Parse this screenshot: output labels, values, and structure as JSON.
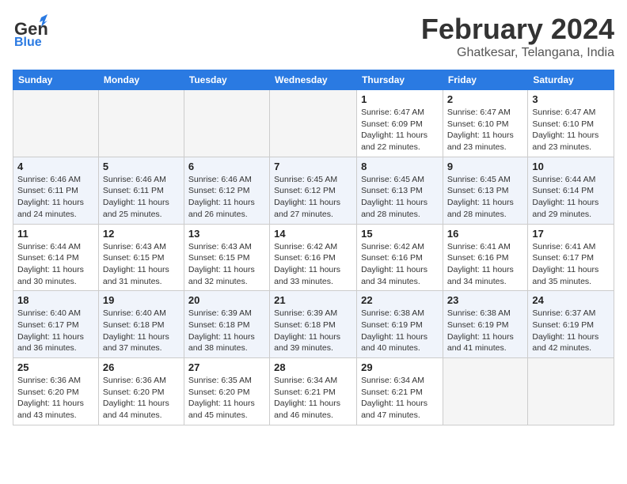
{
  "header": {
    "logo_line1": "General",
    "logo_line2": "Blue",
    "month": "February 2024",
    "location": "Ghatkesar, Telangana, India"
  },
  "weekdays": [
    "Sunday",
    "Monday",
    "Tuesday",
    "Wednesday",
    "Thursday",
    "Friday",
    "Saturday"
  ],
  "weeks": [
    [
      {
        "day": "",
        "info": ""
      },
      {
        "day": "",
        "info": ""
      },
      {
        "day": "",
        "info": ""
      },
      {
        "day": "",
        "info": ""
      },
      {
        "day": "1",
        "info": "Sunrise: 6:47 AM\nSunset: 6:09 PM\nDaylight: 11 hours\nand 22 minutes."
      },
      {
        "day": "2",
        "info": "Sunrise: 6:47 AM\nSunset: 6:10 PM\nDaylight: 11 hours\nand 23 minutes."
      },
      {
        "day": "3",
        "info": "Sunrise: 6:47 AM\nSunset: 6:10 PM\nDaylight: 11 hours\nand 23 minutes."
      }
    ],
    [
      {
        "day": "4",
        "info": "Sunrise: 6:46 AM\nSunset: 6:11 PM\nDaylight: 11 hours\nand 24 minutes."
      },
      {
        "day": "5",
        "info": "Sunrise: 6:46 AM\nSunset: 6:11 PM\nDaylight: 11 hours\nand 25 minutes."
      },
      {
        "day": "6",
        "info": "Sunrise: 6:46 AM\nSunset: 6:12 PM\nDaylight: 11 hours\nand 26 minutes."
      },
      {
        "day": "7",
        "info": "Sunrise: 6:45 AM\nSunset: 6:12 PM\nDaylight: 11 hours\nand 27 minutes."
      },
      {
        "day": "8",
        "info": "Sunrise: 6:45 AM\nSunset: 6:13 PM\nDaylight: 11 hours\nand 28 minutes."
      },
      {
        "day": "9",
        "info": "Sunrise: 6:45 AM\nSunset: 6:13 PM\nDaylight: 11 hours\nand 28 minutes."
      },
      {
        "day": "10",
        "info": "Sunrise: 6:44 AM\nSunset: 6:14 PM\nDaylight: 11 hours\nand 29 minutes."
      }
    ],
    [
      {
        "day": "11",
        "info": "Sunrise: 6:44 AM\nSunset: 6:14 PM\nDaylight: 11 hours\nand 30 minutes."
      },
      {
        "day": "12",
        "info": "Sunrise: 6:43 AM\nSunset: 6:15 PM\nDaylight: 11 hours\nand 31 minutes."
      },
      {
        "day": "13",
        "info": "Sunrise: 6:43 AM\nSunset: 6:15 PM\nDaylight: 11 hours\nand 32 minutes."
      },
      {
        "day": "14",
        "info": "Sunrise: 6:42 AM\nSunset: 6:16 PM\nDaylight: 11 hours\nand 33 minutes."
      },
      {
        "day": "15",
        "info": "Sunrise: 6:42 AM\nSunset: 6:16 PM\nDaylight: 11 hours\nand 34 minutes."
      },
      {
        "day": "16",
        "info": "Sunrise: 6:41 AM\nSunset: 6:16 PM\nDaylight: 11 hours\nand 34 minutes."
      },
      {
        "day": "17",
        "info": "Sunrise: 6:41 AM\nSunset: 6:17 PM\nDaylight: 11 hours\nand 35 minutes."
      }
    ],
    [
      {
        "day": "18",
        "info": "Sunrise: 6:40 AM\nSunset: 6:17 PM\nDaylight: 11 hours\nand 36 minutes."
      },
      {
        "day": "19",
        "info": "Sunrise: 6:40 AM\nSunset: 6:18 PM\nDaylight: 11 hours\nand 37 minutes."
      },
      {
        "day": "20",
        "info": "Sunrise: 6:39 AM\nSunset: 6:18 PM\nDaylight: 11 hours\nand 38 minutes."
      },
      {
        "day": "21",
        "info": "Sunrise: 6:39 AM\nSunset: 6:18 PM\nDaylight: 11 hours\nand 39 minutes."
      },
      {
        "day": "22",
        "info": "Sunrise: 6:38 AM\nSunset: 6:19 PM\nDaylight: 11 hours\nand 40 minutes."
      },
      {
        "day": "23",
        "info": "Sunrise: 6:38 AM\nSunset: 6:19 PM\nDaylight: 11 hours\nand 41 minutes."
      },
      {
        "day": "24",
        "info": "Sunrise: 6:37 AM\nSunset: 6:19 PM\nDaylight: 11 hours\nand 42 minutes."
      }
    ],
    [
      {
        "day": "25",
        "info": "Sunrise: 6:36 AM\nSunset: 6:20 PM\nDaylight: 11 hours\nand 43 minutes."
      },
      {
        "day": "26",
        "info": "Sunrise: 6:36 AM\nSunset: 6:20 PM\nDaylight: 11 hours\nand 44 minutes."
      },
      {
        "day": "27",
        "info": "Sunrise: 6:35 AM\nSunset: 6:20 PM\nDaylight: 11 hours\nand 45 minutes."
      },
      {
        "day": "28",
        "info": "Sunrise: 6:34 AM\nSunset: 6:21 PM\nDaylight: 11 hours\nand 46 minutes."
      },
      {
        "day": "29",
        "info": "Sunrise: 6:34 AM\nSunset: 6:21 PM\nDaylight: 11 hours\nand 47 minutes."
      },
      {
        "day": "",
        "info": ""
      },
      {
        "day": "",
        "info": ""
      }
    ]
  ]
}
